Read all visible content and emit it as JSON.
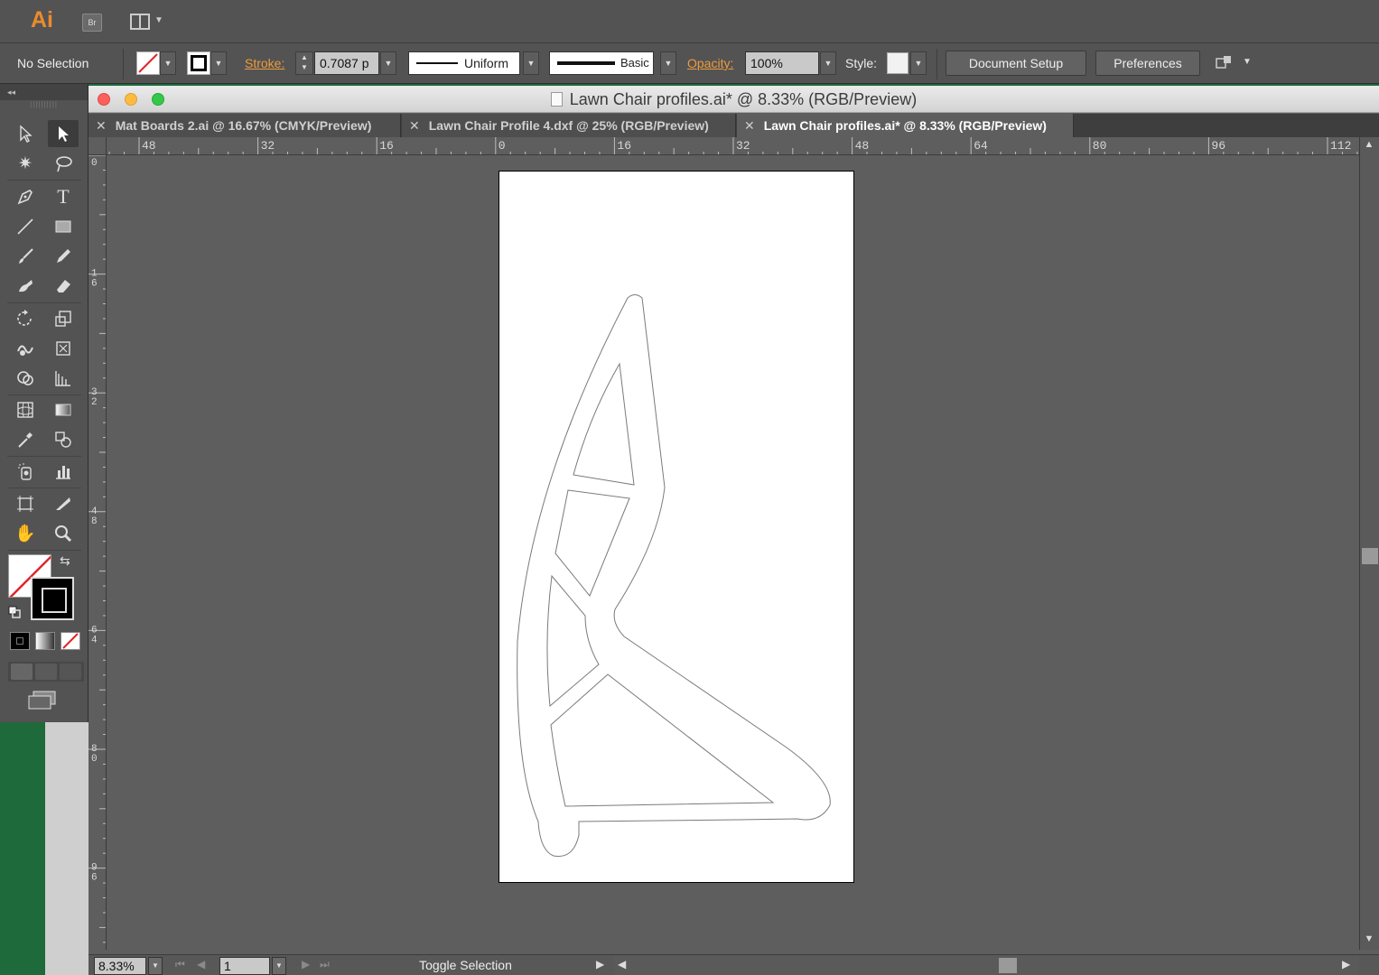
{
  "app": {
    "logo": "Ai",
    "bridge_label": "Br"
  },
  "control": {
    "selection": "No Selection",
    "stroke_label": "Stroke:",
    "stroke_weight": "0.7087 p",
    "profile": "Uniform",
    "brush": "Basic",
    "opacity_label": "Opacity:",
    "opacity": "100%",
    "style_label": "Style:",
    "document_setup": "Document Setup",
    "preferences": "Preferences"
  },
  "window": {
    "title": "Lawn Chair profiles.ai* @ 8.33% (RGB/Preview)"
  },
  "tabs": [
    {
      "label": "Mat Boards 2.ai @ 16.67% (CMYK/Preview)",
      "active": false
    },
    {
      "label": "Lawn Chair Profile 4.dxf @ 25% (RGB/Preview)",
      "active": false
    },
    {
      "label": "Lawn Chair profiles.ai* @ 8.33% (RGB/Preview)",
      "active": true
    }
  ],
  "rulers": {
    "horizontal": [
      "48",
      "32",
      "16",
      "0",
      "16",
      "32",
      "48",
      "64",
      "80",
      "96",
      "112"
    ],
    "vertical": [
      "0",
      "16",
      "32",
      "48",
      "64",
      "80",
      "96"
    ]
  },
  "status": {
    "zoom": "8.33%",
    "page": "1",
    "text": "Toggle Selection"
  },
  "tools": [
    "selection-tool",
    "direct-selection-tool",
    "magic-wand-tool",
    "lasso-tool",
    "pen-tool",
    "type-tool",
    "line-segment-tool",
    "rectangle-tool",
    "paintbrush-tool",
    "pencil-tool",
    "blob-brush-tool",
    "eraser-tool",
    "rotate-tool",
    "scale-tool",
    "warp-tool",
    "free-transform-tool",
    "shape-builder-tool",
    "perspective-grid-tool",
    "mesh-tool",
    "gradient-tool",
    "eyedropper-tool",
    "blend-tool",
    "symbol-sprayer-tool",
    "column-graph-tool",
    "artboard-tool",
    "slice-tool",
    "hand-tool",
    "zoom-tool"
  ],
  "colors": {
    "accent": "#f09a3c",
    "ui_bg": "#535353",
    "canvas_bg": "#5e5e5e"
  }
}
